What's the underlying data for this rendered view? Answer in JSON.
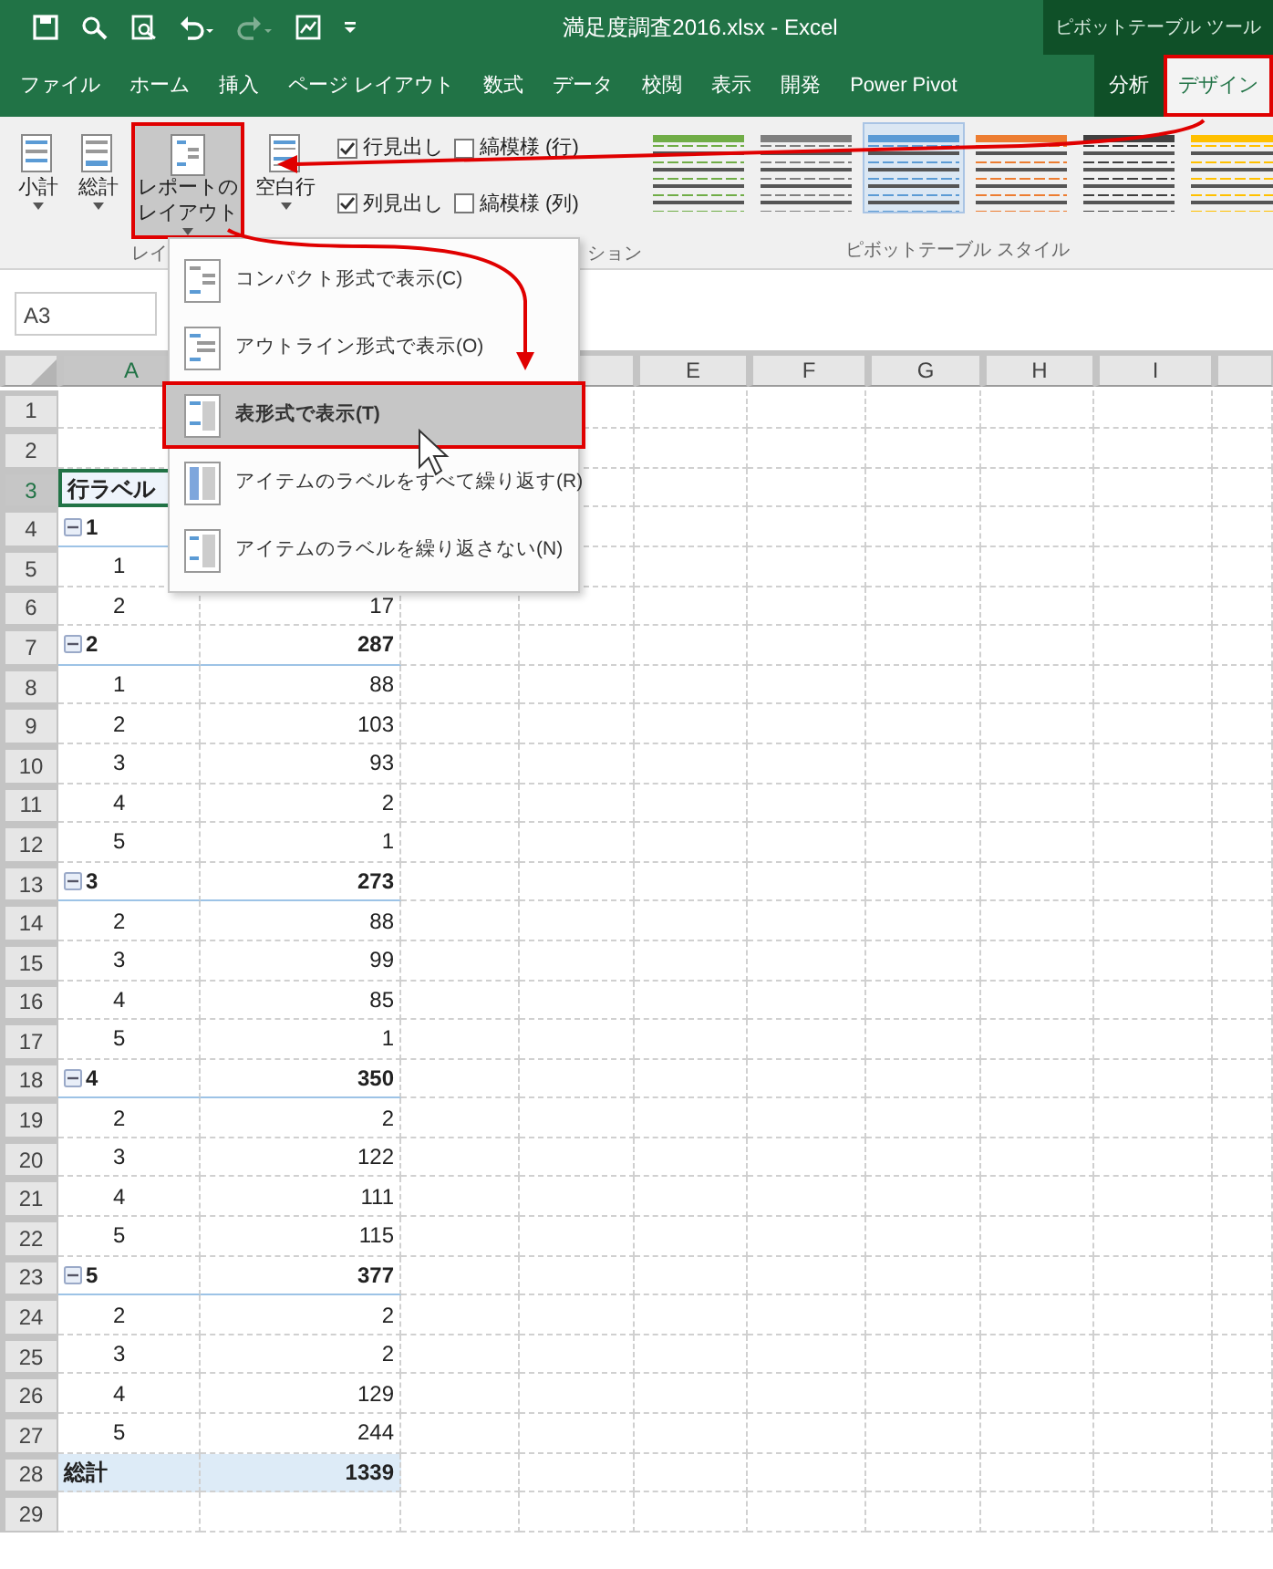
{
  "window": {
    "title": "満足度調査2016.xlsx - Excel",
    "context_label": "ピボットテーブル ツール"
  },
  "tabs": [
    {
      "label": "ファイル",
      "selected": false,
      "contextual": false,
      "highlighted": false
    },
    {
      "label": "ホーム",
      "selected": false,
      "contextual": false,
      "highlighted": false
    },
    {
      "label": "挿入",
      "selected": false,
      "contextual": false,
      "highlighted": false
    },
    {
      "label": "ページ レイアウト",
      "selected": false,
      "contextual": false,
      "highlighted": false
    },
    {
      "label": "数式",
      "selected": false,
      "contextual": false,
      "highlighted": false
    },
    {
      "label": "データ",
      "selected": false,
      "contextual": false,
      "highlighted": false
    },
    {
      "label": "校閲",
      "selected": false,
      "contextual": false,
      "highlighted": false
    },
    {
      "label": "表示",
      "selected": false,
      "contextual": false,
      "highlighted": false
    },
    {
      "label": "開発",
      "selected": false,
      "contextual": false,
      "highlighted": false
    },
    {
      "label": "Power Pivot",
      "selected": false,
      "contextual": false,
      "highlighted": false
    },
    {
      "label": "分析",
      "selected": false,
      "contextual": true,
      "highlighted": false
    },
    {
      "label": "デザイン",
      "selected": true,
      "contextual": true,
      "highlighted": true
    }
  ],
  "ribbon": {
    "buttons": [
      {
        "label": "小計",
        "pressed": false,
        "highlighted": false
      },
      {
        "label": "総計",
        "pressed": false,
        "highlighted": false
      },
      {
        "label": "レポートのレイアウト",
        "pressed": true,
        "highlighted": true
      },
      {
        "label": "空白行",
        "pressed": false,
        "highlighted": false
      }
    ],
    "checkboxes": [
      {
        "label": "行見出し",
        "checked": true
      },
      {
        "label": "縞模様 (行)",
        "checked": false
      },
      {
        "label": "列見出し",
        "checked": true
      },
      {
        "label": "縞模様 (列)",
        "checked": false
      }
    ],
    "styles": [
      {
        "color": "#70ad47",
        "selected": false
      },
      {
        "color": "#7f7f7f",
        "selected": false
      },
      {
        "color": "#5b9bd5",
        "selected": true
      },
      {
        "color": "#ed7d31",
        "selected": false
      },
      {
        "color": "#404040",
        "selected": false
      },
      {
        "color": "#ffc000",
        "selected": false
      }
    ],
    "group_labels": [
      "レイ",
      "ション",
      "ピボットテーブル スタイル"
    ]
  },
  "name_box": "A3",
  "columns": [
    "A",
    "E",
    "F",
    "G",
    "H",
    "I"
  ],
  "rows": [
    {
      "number": "1",
      "kind": "blank",
      "selected": false
    },
    {
      "number": "2",
      "kind": "blank",
      "selected": false
    },
    {
      "number": "3",
      "kind": "header",
      "label": "行ラベル",
      "selected": true
    },
    {
      "number": "4",
      "kind": "group",
      "label": "1",
      "expanded": true,
      "selected": false
    },
    {
      "number": "5",
      "kind": "item",
      "label": "1",
      "selected": false
    },
    {
      "number": "6",
      "kind": "item",
      "label": "2",
      "value": "17",
      "selected": false
    },
    {
      "number": "7",
      "kind": "group",
      "label": "2",
      "value": "287",
      "expanded": true,
      "selected": false
    },
    {
      "number": "8",
      "kind": "item",
      "label": "1",
      "value": "88",
      "selected": false
    },
    {
      "number": "9",
      "kind": "item",
      "label": "2",
      "value": "103",
      "selected": false
    },
    {
      "number": "10",
      "kind": "item",
      "label": "3",
      "value": "93",
      "selected": false
    },
    {
      "number": "11",
      "kind": "item",
      "label": "4",
      "value": "2",
      "selected": false
    },
    {
      "number": "12",
      "kind": "item",
      "label": "5",
      "value": "1",
      "selected": false
    },
    {
      "number": "13",
      "kind": "group",
      "label": "3",
      "value": "273",
      "expanded": true,
      "selected": false
    },
    {
      "number": "14",
      "kind": "item",
      "label": "2",
      "value": "88",
      "selected": false
    },
    {
      "number": "15",
      "kind": "item",
      "label": "3",
      "value": "99",
      "selected": false
    },
    {
      "number": "16",
      "kind": "item",
      "label": "4",
      "value": "85",
      "selected": false
    },
    {
      "number": "17",
      "kind": "item",
      "label": "5",
      "value": "1",
      "selected": false
    },
    {
      "number": "18",
      "kind": "group",
      "label": "4",
      "value": "350",
      "expanded": true,
      "selected": false
    },
    {
      "number": "19",
      "kind": "item",
      "label": "2",
      "value": "2",
      "selected": false
    },
    {
      "number": "20",
      "kind": "item",
      "label": "3",
      "value": "122",
      "selected": false
    },
    {
      "number": "21",
      "kind": "item",
      "label": "4",
      "value": "111",
      "selected": false
    },
    {
      "number": "22",
      "kind": "item",
      "label": "5",
      "value": "115",
      "selected": false
    },
    {
      "number": "23",
      "kind": "group",
      "label": "5",
      "value": "377",
      "expanded": true,
      "selected": false
    },
    {
      "number": "24",
      "kind": "item",
      "label": "2",
      "value": "2",
      "selected": false
    },
    {
      "number": "25",
      "kind": "item",
      "label": "3",
      "value": "2",
      "selected": false
    },
    {
      "number": "26",
      "kind": "item",
      "label": "4",
      "value": "129",
      "selected": false
    },
    {
      "number": "27",
      "kind": "item",
      "label": "5",
      "value": "244",
      "selected": false
    },
    {
      "number": "28",
      "kind": "total",
      "label": "総計",
      "value": "1339",
      "selected": false
    },
    {
      "number": "29",
      "kind": "blank",
      "selected": false
    }
  ],
  "menu": {
    "items": [
      {
        "label": "コンパクト形式で表示(C)",
        "selected": false,
        "highlighted": false
      },
      {
        "label": "アウトライン形式で表示(O)",
        "selected": false,
        "highlighted": false
      },
      {
        "label": "表形式で表示(T)",
        "selected": true,
        "highlighted": true
      },
      {
        "label": "アイテムのラベルをすべて繰り返す(R)",
        "selected": false,
        "highlighted": false
      },
      {
        "label": "アイテムのラベルを繰り返さない(N)",
        "selected": false,
        "highlighted": false
      }
    ]
  }
}
